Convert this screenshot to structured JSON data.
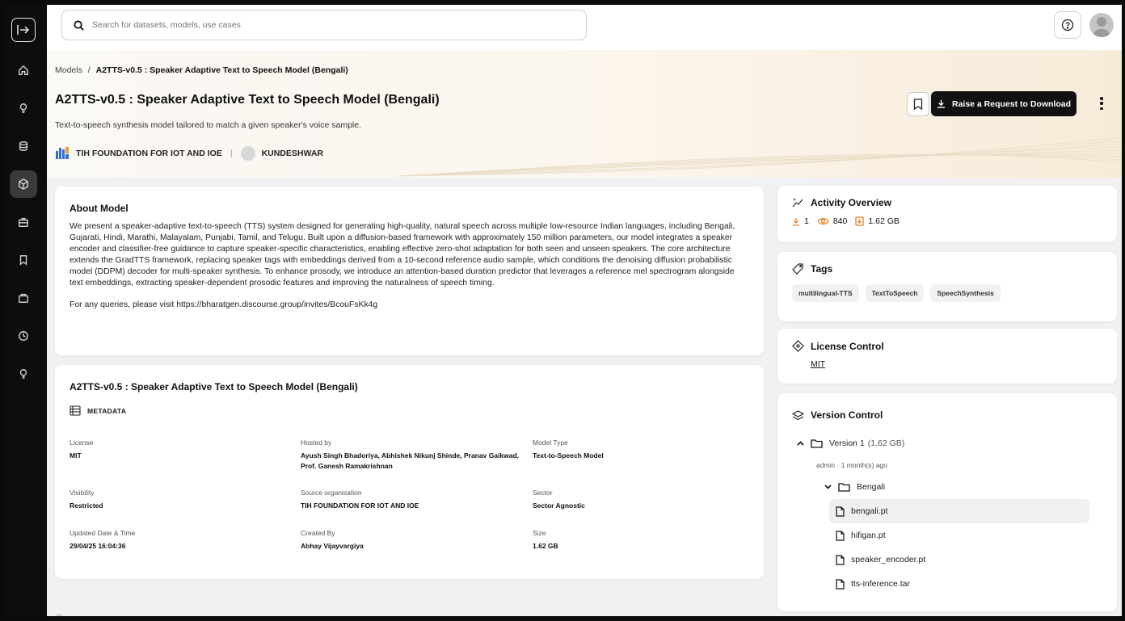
{
  "search": {
    "placeholder": "Search for datasets, models, use cases"
  },
  "breadcrumb": {
    "root": "Models",
    "separator": "/",
    "current": "A2TTS-v0.5 : Speaker Adaptive Text to Speech Model (Bengali)"
  },
  "header": {
    "title": "A2TTS-v0.5 : Speaker Adaptive Text to Speech Model (Bengali)",
    "subtitle": "Text-to-speech synthesis model tailored to match a given speaker's voice sample.",
    "organisation": "TIH FOUNDATION FOR IOT AND IOE",
    "separator": "|",
    "user": "KUNDESHWAR",
    "download_label": "Raise a Request to Download"
  },
  "about": {
    "title": "About Model",
    "description": "We present a speaker-adaptive text-to-speech (TTS) system designed for generating high-quality, natural speech across multiple low-resource Indian languages, including Bengali, Gujarati, Hindi, Marathi, Malayalam, Punjabi, Tamil, and Telugu. Built upon a diffusion-based framework with approximately 150 million parameters, our model integrates a speaker encoder and classifier-free guidance to capture speaker-specific characteristics, enabling effective zero-shot adaptation for both seen and unseen speakers. The core architecture extends the GradTTS framework, replacing speaker tags with embeddings derived from a 10-second reference audio sample, which conditions the denoising diffusion probabilistic model (DDPM) decoder for multi-speaker synthesis. To enhance prosody, we introduce an attention-based duration predictor that leverages a reference mel spectrogram alongside text embeddings, extracting speaker-dependent prosodic features and improving the naturalness of speech timing.",
    "queries": "For any queries, please visit https://bharatgen.discourse.group/invites/BcouFsKk4g"
  },
  "metadata": {
    "title": "A2TTS-v0.5 : Speaker Adaptive Text to Speech Model (Bengali)",
    "section_label": "METADATA",
    "fields": [
      {
        "label": "License",
        "value": "MIT"
      },
      {
        "label": "Hosted by",
        "value": "Ayush Singh Bhadoriya, Abhishek Nikunj Shinde, Pranav Gaikwad, Prof. Ganesh Ramakrishnan"
      },
      {
        "label": "Model Type",
        "value": "Text-to-Speech Model"
      },
      {
        "label": "Visibility",
        "value": "Restricted"
      },
      {
        "label": "Source organisation",
        "value": "TIH FOUNDATION FOR IOT AND IOE"
      },
      {
        "label": "Sector",
        "value": "Sector Agnostic"
      },
      {
        "label": "Updated Date & Time",
        "value": "29/04/25 16:04:36"
      },
      {
        "label": "Created By",
        "value": "Abhay Vijayvargiya"
      },
      {
        "label": "Size",
        "value": "1.62 GB"
      }
    ]
  },
  "activity": {
    "title": "Activity Overview",
    "downloads": "1",
    "views": "840",
    "size": "1.62 GB"
  },
  "tags": {
    "title": "Tags",
    "items": [
      "multilingual-TTS",
      "TextToSpeech",
      "SpeechSynthesis"
    ]
  },
  "license": {
    "title": "License Control",
    "value": "MIT"
  },
  "version": {
    "title": "Version Control",
    "version_label": "Version 1",
    "version_size": "(1.62 GB)",
    "meta": "admin · 1 month(s) ago",
    "folder": "Bengali",
    "files": [
      "bengali.pt",
      "hifigan.pt",
      "speaker_encoder.pt",
      "tts-inference.tar"
    ]
  },
  "icons": {
    "sidebar": [
      "home-icon",
      "bulb-icon",
      "database-icon",
      "cube-icon",
      "briefcase-icon",
      "bookmark-icon",
      "bag-icon",
      "clock-icon",
      "bulb-icon"
    ]
  },
  "colors": {
    "accent_orange": "#e67e22",
    "dark": "#111111",
    "hero_warm": "#f7ebd8"
  }
}
